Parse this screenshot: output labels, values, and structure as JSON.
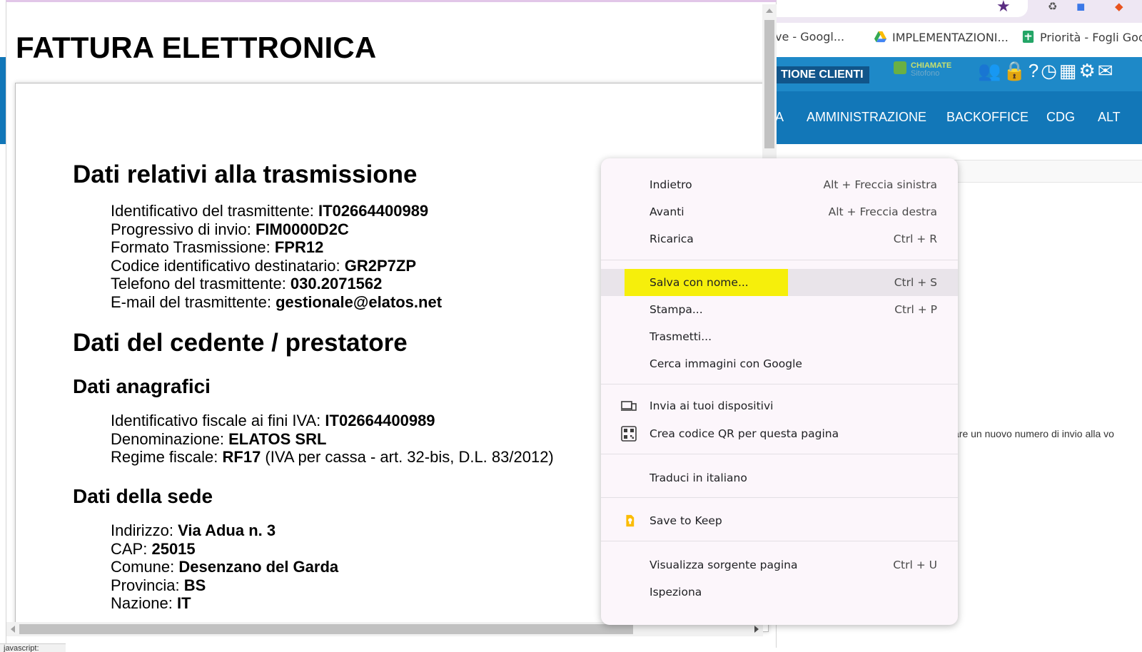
{
  "background": {
    "bookmarks": [
      {
        "label": "ve - Googl...",
        "icon": "none"
      },
      {
        "label": "IMPLEMENTAZIONI...",
        "icon": "google-drive-icon"
      },
      {
        "label": "Priorità - Fogli Goo",
        "icon": "google-sheets-icon"
      }
    ],
    "topbar_tag": "TIONE CLIENTI",
    "chiamate_label": "CHIAMATE",
    "chiamate_sub": "Sitofono",
    "nav_items": [
      "A",
      "AMMINISTRAZIONE",
      "BACKOFFICE",
      "CDG",
      "ALT"
    ],
    "partial_text": "are un nuovo numero di invio alla vo",
    "status_text": "javascript:"
  },
  "document": {
    "title": "FATTURA ELETTRONICA",
    "section_trasmissione": {
      "heading": "Dati relativi alla trasmissione",
      "rows": [
        {
          "label": "Identificativo del trasmittente: ",
          "value": "IT02664400989"
        },
        {
          "label": "Progressivo di invio: ",
          "value": "FIM0000D2C"
        },
        {
          "label": "Formato Trasmissione: ",
          "value": "FPR12"
        },
        {
          "label": "Codice identificativo destinatario: ",
          "value": "GR2P7ZP"
        },
        {
          "label": "Telefono del trasmittente: ",
          "value": "030.2071562"
        },
        {
          "label": "E-mail del trasmittente: ",
          "value": "gestionale@elatos.net"
        }
      ]
    },
    "section_cedente": {
      "heading": "Dati del cedente / prestatore",
      "anagrafici": {
        "heading": "Dati anagrafici",
        "rows": [
          {
            "label": "Identificativo fiscale ai fini IVA: ",
            "value": "IT02664400989",
            "note": ""
          },
          {
            "label": "Denominazione: ",
            "value": "ELATOS SRL",
            "note": ""
          },
          {
            "label": "Regime fiscale: ",
            "value": "RF17",
            "note": " (IVA per cassa - art. 32-bis, D.L. 83/2012)"
          }
        ]
      },
      "sede": {
        "heading": "Dati della sede",
        "rows": [
          {
            "label": "Indirizzo: ",
            "value": "Via Adua n. 3"
          },
          {
            "label": "CAP: ",
            "value": "25015"
          },
          {
            "label": "Comune: ",
            "value": "Desenzano del Garda"
          },
          {
            "label": "Provincia: ",
            "value": "BS"
          },
          {
            "label": "Nazione: ",
            "value": "IT"
          }
        ]
      }
    }
  },
  "context_menu": {
    "items": [
      {
        "label": "Indietro",
        "shortcut": "Alt + Freccia sinistra"
      },
      {
        "label": "Avanti",
        "shortcut": "Alt + Freccia destra"
      },
      {
        "label": "Ricarica",
        "shortcut": "Ctrl + R"
      },
      {
        "label": "Salva con nome...",
        "shortcut": "Ctrl + S",
        "highlighted": true
      },
      {
        "label": "Stampa...",
        "shortcut": "Ctrl + P"
      },
      {
        "label": "Trasmetti...",
        "shortcut": ""
      },
      {
        "label": "Cerca immagini con Google",
        "shortcut": ""
      },
      {
        "label": "Invia ai tuoi dispositivi",
        "shortcut": "",
        "icon": "devices-icon"
      },
      {
        "label": "Crea codice QR per questa pagina",
        "shortcut": "",
        "icon": "qr-code-icon"
      },
      {
        "label": "Traduci in italiano",
        "shortcut": ""
      },
      {
        "label": "Save to Keep",
        "shortcut": "",
        "icon": "keep-icon"
      },
      {
        "label": "Visualizza sorgente pagina",
        "shortcut": "Ctrl + U"
      },
      {
        "label": "Ispeziona",
        "shortcut": ""
      }
    ]
  },
  "colors": {
    "highlight_marker": "#f6ef0b",
    "app_nav_blue": "#1277b8",
    "app_topbar_blue": "#1e89c8",
    "menu_bg": "#fcf6fb"
  }
}
